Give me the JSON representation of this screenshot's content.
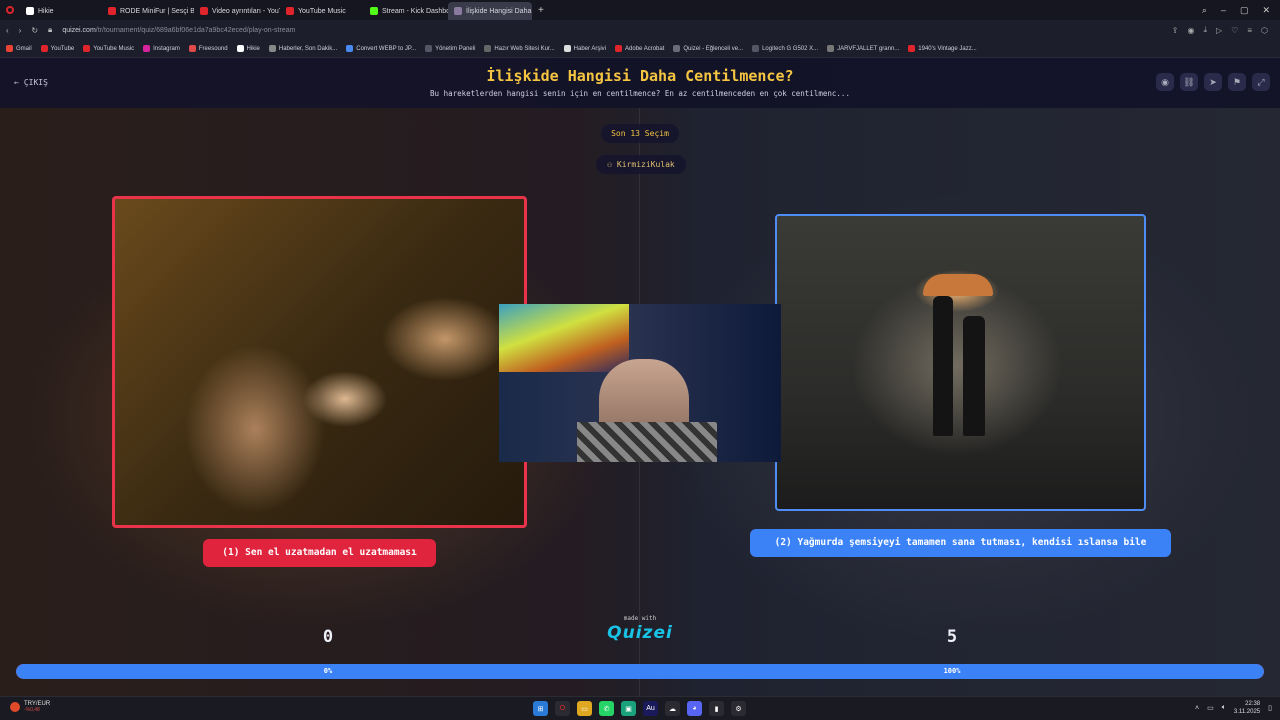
{
  "browser": {
    "tabs": [
      {
        "label": "Hikie",
        "color": "#ffffff",
        "active": false
      },
      {
        "label": "RODE MiniFur | Sesçi Baba",
        "color": "#e0242b",
        "active": false
      },
      {
        "label": "Video ayrıntıları - YouTube",
        "color": "#e0242b",
        "active": false
      },
      {
        "label": "YouTube Music",
        "color": "#e0242b",
        "active": false
      },
      {
        "label": "Stream - Kick Dashboard",
        "color": "#53fc18",
        "active": false
      },
      {
        "label": "İlişkide Hangisi Daha Cen",
        "color": "#8a7aa0",
        "active": true
      }
    ],
    "url_host": "quizei.com",
    "url_path": "/tr/tournament/quiz/689a6bf06e1da7a9bc42eced/play-on-stream",
    "bookmarks": [
      {
        "label": "Gmail",
        "color": "#ea4335"
      },
      {
        "label": "YouTube",
        "color": "#e0242b"
      },
      {
        "label": "YouTube Music",
        "color": "#e0242b"
      },
      {
        "label": "Instagram",
        "color": "#d6249f"
      },
      {
        "label": "Freesound",
        "color": "#e04a4a"
      },
      {
        "label": "Hikie",
        "color": "#ffffff"
      },
      {
        "label": "Haberler, Son Dakik...",
        "color": "#888888"
      },
      {
        "label": "Convert WEBP to JP...",
        "color": "#4a8af0"
      },
      {
        "label": "Yönetim Paneli",
        "color": "#555566"
      },
      {
        "label": "Hazır Web Sitesi Kur...",
        "color": "#666666"
      },
      {
        "label": "Haber Arşivi",
        "color": "#dddddd"
      },
      {
        "label": "Adobe Acrobat",
        "color": "#e0242b"
      },
      {
        "label": "Quizei - Eğlenceli ve...",
        "color": "#6a6a7a"
      },
      {
        "label": "Logitech G G502 X...",
        "color": "#555566"
      },
      {
        "label": "JARVFJALLET grann...",
        "color": "#777777"
      },
      {
        "label": "1940's Vintage Jazz...",
        "color": "#e0242b"
      }
    ]
  },
  "header": {
    "exit_label": "ÇIKIŞ",
    "title": "İlişkide Hangisi Daha Centilmence?",
    "subtitle": "Bu hareketlerden hangisi senin için en centilmence? En az centilmenceden en çok centilmenc..."
  },
  "round_label": "Son 13 Seçim",
  "streamer": "KirmiziKulak",
  "choices": {
    "left": {
      "label": "(1) Sen el uzatmadan el uzatmaması",
      "votes": "0",
      "percent": "0%",
      "accent": "#e0243e"
    },
    "right": {
      "label": "(2) Yağmurda şemsiyeyi tamamen sana tutması, kendisi ıslansa bile",
      "votes": "5",
      "percent": "100%",
      "accent": "#3b82f6"
    }
  },
  "progress": {
    "right_fraction": 1.0
  },
  "branding": {
    "made_with": "made with",
    "logo": "Quizei"
  },
  "taskbar": {
    "ticker": "TRY/EUR",
    "ticker_change": "-%0,48",
    "time": "22:38",
    "date": "3.11.2025"
  }
}
